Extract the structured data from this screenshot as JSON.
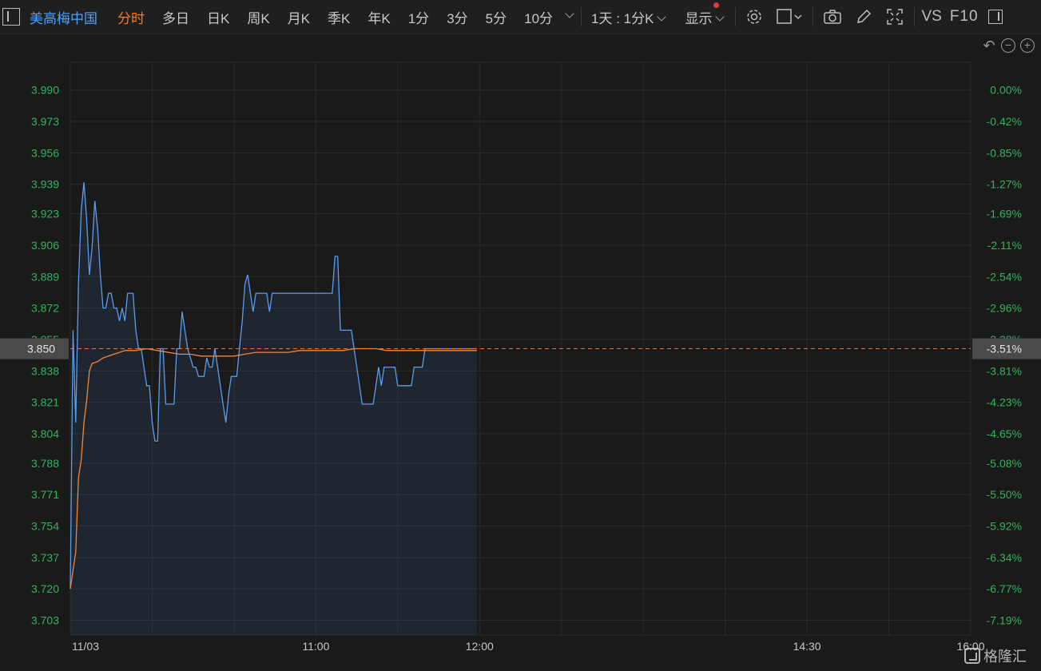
{
  "toolbar": {
    "stock_name": "美高梅中国",
    "tabs": [
      "分时",
      "多日",
      "日K",
      "周K",
      "月K",
      "季K",
      "年K",
      "1分",
      "3分",
      "5分",
      "10分"
    ],
    "active_tab": "分时",
    "period_select": "1天 : 1分K",
    "display_label": "显示",
    "vs_label": "VS",
    "f10_label": "F10"
  },
  "icons": [
    "panel-toggle-icon",
    "gear-icon",
    "rect-select-icon",
    "camera-icon",
    "pencil-icon",
    "fullscreen-icon",
    "undo-icon",
    "zoom-out-icon",
    "zoom-in-icon"
  ],
  "colors": {
    "price_line": "#5b9cf0",
    "avg_line": "#f0873a",
    "axis_text_green": "#33b35a",
    "ref_line": "#e07a3a",
    "active_tab": "#ff7a1a",
    "stock_name": "#4aa3ff"
  },
  "watermark": "格隆汇",
  "chart_data": {
    "type": "line",
    "title": "",
    "ref_price": 3.85,
    "ref_price_label": "3.850",
    "ref_pct_label": "-3.51%",
    "ylim": [
      3.695,
      4.005
    ],
    "y_ticks": [
      3.99,
      3.973,
      3.956,
      3.939,
      3.923,
      3.906,
      3.889,
      3.872,
      3.855,
      3.838,
      3.821,
      3.804,
      3.788,
      3.771,
      3.754,
      3.737,
      3.72,
      3.703
    ],
    "y_tick_labels": [
      "3.990",
      "3.973",
      "3.956",
      "3.939",
      "3.923",
      "3.906",
      "3.889",
      "3.872",
      "3.855",
      "3.838",
      "3.821",
      "3.804",
      "3.788",
      "3.771",
      "3.754",
      "3.737",
      "3.720",
      "3.703"
    ],
    "pct_tick_labels": [
      "0.00%",
      "-0.42%",
      "-0.85%",
      "-1.27%",
      "-1.69%",
      "-2.11%",
      "-2.54%",
      "-2.96%",
      "-3.38%",
      "-3.81%",
      "-4.23%",
      "-4.65%",
      "-5.08%",
      "-5.50%",
      "-5.92%",
      "-6.34%",
      "-6.77%",
      "-7.19%"
    ],
    "x_labels": [
      "11/03",
      "11:00",
      "12:00",
      "14:30",
      "16:00"
    ],
    "x_range": [
      0,
      330
    ],
    "x_label_minutes": [
      0,
      90,
      150,
      270,
      330
    ],
    "series": [
      {
        "name": "price",
        "x": [
          0,
          1,
          2,
          3,
          4,
          5,
          6,
          7,
          8,
          9,
          10,
          11,
          12,
          13,
          14,
          15,
          16,
          17,
          18,
          19,
          20,
          21,
          22,
          23,
          24,
          25,
          26,
          27,
          28,
          29,
          30,
          31,
          32,
          33,
          34,
          35,
          36,
          37,
          38,
          39,
          40,
          41,
          42,
          43,
          44,
          45,
          46,
          47,
          48,
          49,
          50,
          51,
          52,
          53,
          54,
          55,
          56,
          57,
          58,
          59,
          60,
          61,
          62,
          63,
          64,
          65,
          66,
          67,
          68,
          69,
          70,
          71,
          72,
          73,
          74,
          75,
          76,
          77,
          78,
          79,
          80,
          81,
          82,
          83,
          84,
          85,
          86,
          87,
          88,
          89,
          90,
          91,
          92,
          93,
          94,
          95,
          96,
          97,
          98,
          99,
          100,
          101,
          102,
          103,
          104,
          105,
          106,
          107,
          108,
          109,
          110,
          111,
          112,
          113,
          114,
          115,
          116,
          117,
          118,
          119,
          120,
          121,
          122,
          123,
          124,
          125,
          126,
          127,
          128,
          129,
          130,
          131,
          132,
          133,
          134,
          135,
          136,
          137,
          138,
          139,
          140,
          141,
          142,
          143,
          144,
          145,
          146,
          147,
          148,
          149
        ],
        "values": [
          3.72,
          3.86,
          3.81,
          3.885,
          3.925,
          3.94,
          3.92,
          3.89,
          3.905,
          3.93,
          3.915,
          3.89,
          3.872,
          3.872,
          3.88,
          3.88,
          3.872,
          3.872,
          3.865,
          3.872,
          3.865,
          3.88,
          3.88,
          3.88,
          3.86,
          3.85,
          3.85,
          3.84,
          3.83,
          3.83,
          3.81,
          3.8,
          3.8,
          3.85,
          3.85,
          3.82,
          3.82,
          3.82,
          3.82,
          3.85,
          3.85,
          3.87,
          3.86,
          3.85,
          3.845,
          3.84,
          3.84,
          3.835,
          3.835,
          3.835,
          3.845,
          3.84,
          3.84,
          3.85,
          3.84,
          3.83,
          3.82,
          3.81,
          3.825,
          3.835,
          3.835,
          3.835,
          3.85,
          3.865,
          3.885,
          3.89,
          3.88,
          3.87,
          3.88,
          3.88,
          3.88,
          3.88,
          3.88,
          3.87,
          3.88,
          3.88,
          3.88,
          3.88,
          3.88,
          3.88,
          3.88,
          3.88,
          3.88,
          3.88,
          3.88,
          3.88,
          3.88,
          3.88,
          3.88,
          3.88,
          3.88,
          3.88,
          3.88,
          3.88,
          3.88,
          3.88,
          3.88,
          3.9,
          3.9,
          3.86,
          3.86,
          3.86,
          3.86,
          3.86,
          3.85,
          3.84,
          3.83,
          3.82,
          3.82,
          3.82,
          3.82,
          3.82,
          3.83,
          3.84,
          3.83,
          3.84,
          3.84,
          3.84,
          3.84,
          3.84,
          3.83,
          3.83,
          3.83,
          3.83,
          3.83,
          3.83,
          3.84,
          3.84,
          3.84,
          3.84,
          3.85,
          3.85,
          3.85,
          3.85,
          3.85,
          3.85,
          3.85,
          3.85,
          3.85,
          3.85,
          3.85,
          3.85,
          3.85,
          3.85,
          3.85,
          3.85,
          3.85,
          3.85,
          3.85,
          3.85
        ]
      },
      {
        "name": "average",
        "x": [
          0,
          1,
          2,
          3,
          4,
          5,
          6,
          7,
          8,
          10,
          12,
          14,
          16,
          18,
          20,
          24,
          28,
          32,
          36,
          40,
          44,
          48,
          52,
          56,
          60,
          64,
          68,
          72,
          76,
          80,
          84,
          88,
          92,
          96,
          100,
          104,
          108,
          112,
          116,
          120,
          124,
          128,
          132,
          136,
          140,
          144,
          149
        ],
        "values": [
          3.72,
          3.73,
          3.74,
          3.78,
          3.79,
          3.81,
          3.822,
          3.838,
          3.842,
          3.843,
          3.845,
          3.846,
          3.847,
          3.848,
          3.849,
          3.849,
          3.85,
          3.849,
          3.848,
          3.847,
          3.847,
          3.846,
          3.846,
          3.846,
          3.846,
          3.847,
          3.848,
          3.848,
          3.848,
          3.848,
          3.849,
          3.849,
          3.849,
          3.849,
          3.849,
          3.85,
          3.85,
          3.85,
          3.849,
          3.849,
          3.849,
          3.849,
          3.849,
          3.849,
          3.849,
          3.849,
          3.849
        ]
      }
    ],
    "grid": true
  }
}
